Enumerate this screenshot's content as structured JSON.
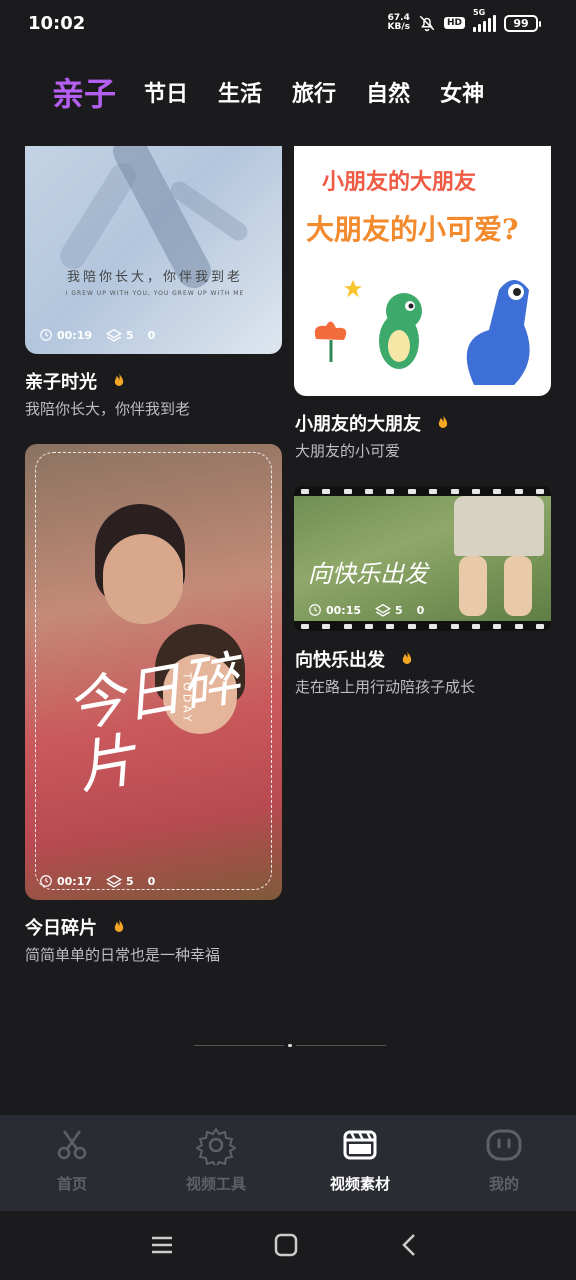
{
  "status": {
    "time": "10:02",
    "net_speed_value": "67.4",
    "net_speed_unit": "KB/s",
    "hd": "HD",
    "signal": "5G",
    "battery": "99"
  },
  "tabs": [
    {
      "label": "亲子",
      "active": true
    },
    {
      "label": "节日",
      "active": false
    },
    {
      "label": "生活",
      "active": false
    },
    {
      "label": "旅行",
      "active": false
    },
    {
      "label": "自然",
      "active": false
    },
    {
      "label": "女神",
      "active": false
    }
  ],
  "cards": [
    {
      "title": "亲子时光",
      "subtitle": "我陪你长大，你伴我到老",
      "overlay_cn": "我陪你长大，你伴我到老",
      "overlay_en": "I GREW UP WITH YOU, YOU GREW UP WITH ME",
      "duration": "00:19",
      "layers": "5",
      "uses": "0"
    },
    {
      "title": "小朋友的大朋友",
      "subtitle": "大朋友的小可爱",
      "overlay_line1": "小朋友的大朋友",
      "overlay_line2": "大朋友的小可爱?"
    },
    {
      "title": "今日碎片",
      "subtitle": "简简单单的日常也是一种幸福",
      "overlay_big": "今日碎片",
      "overlay_today": "TODAY",
      "duration": "00:17",
      "layers": "5",
      "uses": "0"
    },
    {
      "title": "向快乐出发",
      "subtitle": "走在路上用行动陪孩子成长",
      "overlay_text": "向快乐出发",
      "duration": "00:15",
      "layers": "5",
      "uses": "0"
    }
  ],
  "bottom_nav": [
    {
      "label": "首页",
      "icon": "scissors-icon",
      "active": false
    },
    {
      "label": "视频工具",
      "icon": "gear-icon",
      "active": false
    },
    {
      "label": "视频素材",
      "icon": "film-clapper-icon",
      "active": true
    },
    {
      "label": "我的",
      "icon": "face-icon",
      "active": false
    }
  ],
  "colors": {
    "accent": "#b45ff0",
    "background": "#1b1b1d",
    "nav_background": "#2a2c33",
    "fire": "#f5a623"
  }
}
